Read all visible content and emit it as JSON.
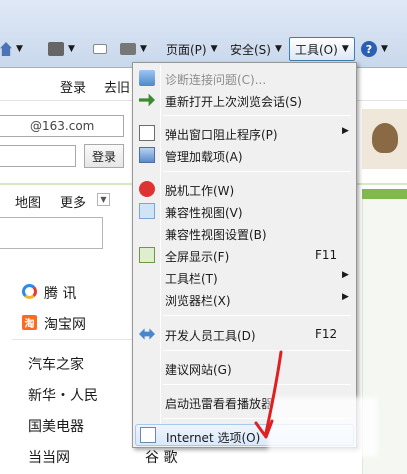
{
  "toolbar": {
    "page_menu": "页面(P)",
    "safety_menu": "安全(S)",
    "tools_menu": "工具(O)",
    "help_icon": "?"
  },
  "page": {
    "login_link": "登录",
    "register_link": "去旧",
    "mail_domain": "@163.com",
    "login_button": "登录",
    "nav": {
      "map": "地图",
      "more": "更多"
    },
    "sites": [
      "腾 讯",
      "淘宝网",
      "汽车之家",
      "新华・人民",
      "国美电器",
      "当当网",
      "谷 歌"
    ]
  },
  "tools_menu": {
    "items": [
      {
        "label": "诊断连接问题(C)...",
        "disabled": true,
        "icon": "diagnose-icon"
      },
      {
        "label": "重新打开上次浏览会话(S)",
        "icon": "reopen-session-icon"
      },
      {
        "label": "弹出窗口阻止程序(P)",
        "submenu": true,
        "icon": "popup-blocker-icon"
      },
      {
        "label": "管理加载项(A)",
        "icon": "manage-addons-icon"
      },
      {
        "label": "脱机工作(W)",
        "icon": "offline-icon"
      },
      {
        "label": "兼容性视图(V)",
        "icon": "compat-view-icon"
      },
      {
        "label": "兼容性视图设置(B)"
      },
      {
        "label": "全屏显示(F)",
        "shortcut": "F11",
        "icon": "fullscreen-icon"
      },
      {
        "label": "工具栏(T)",
        "submenu": true
      },
      {
        "label": "浏览器栏(X)",
        "submenu": true
      },
      {
        "label": "开发人员工具(D)",
        "shortcut": "F12",
        "icon": "dev-tools-icon"
      },
      {
        "label": "建议网站(G)"
      },
      {
        "label": "启动迅雷看看播放器"
      },
      {
        "label": "Internet 选项(O)",
        "icon": "internet-options-icon"
      }
    ],
    "submenu_arrow": "▶"
  },
  "colors": {
    "menu_bg": "#f0f0f0",
    "highlight_border": "#a8c8ef",
    "annotation_red": "#e02020"
  }
}
